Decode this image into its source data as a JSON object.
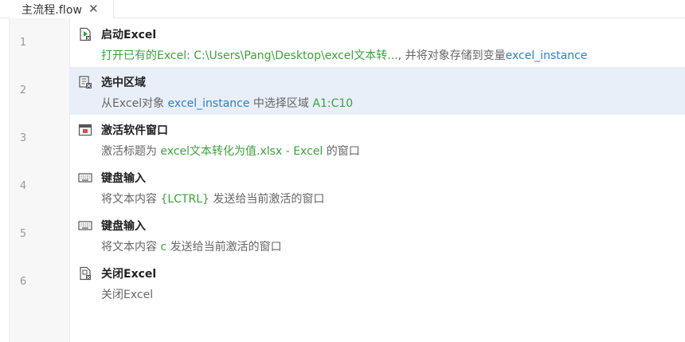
{
  "tab": {
    "label": "主流程.flow",
    "close": "✕"
  },
  "rows": [
    {
      "line": "1",
      "title": "启动Excel",
      "icon": "excel-launch-icon",
      "desc": {
        "t0": "打开已有的Excel: C:\\Users\\Pang\\Desktop\\excel文本转...",
        "t1": ", 并将对象存储到变量",
        "t2": "excel_instance"
      }
    },
    {
      "line": "2",
      "title": "选中区域",
      "icon": "select-range-icon",
      "desc": {
        "t0": "从Excel对象 ",
        "t1": "excel_instance",
        "t2": " 中选择区域 ",
        "t3": "A1:C10"
      }
    },
    {
      "line": "3",
      "title": "激活软件窗口",
      "icon": "window-icon",
      "desc": {
        "t0": "激活标题为 ",
        "t1": "excel文本转化为值.xlsx - Excel",
        "t2": " 的窗口"
      }
    },
    {
      "line": "4",
      "title": "键盘输入",
      "icon": "keyboard-icon",
      "desc": {
        "t0": "将文本内容 ",
        "t1": "{LCTRL}",
        "t2": " 发送给当前激活的窗口"
      }
    },
    {
      "line": "5",
      "title": "键盘输入",
      "icon": "keyboard-icon",
      "desc": {
        "t0": "将文本内容 ",
        "t1": "c",
        "t2": " 发送给当前激活的窗口"
      }
    },
    {
      "line": "6",
      "title": "关闭Excel",
      "icon": "excel-close-icon",
      "desc": {
        "t0": "关闭Excel"
      }
    }
  ],
  "colors": {
    "selected_row": "#e8eff9",
    "value_green": "#3aa33a",
    "variable_blue": "#2a7fd4"
  }
}
